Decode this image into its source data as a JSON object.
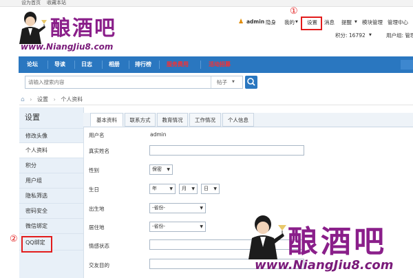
{
  "topbar": {
    "home_link": "设为首页",
    "fav_link": "收藏本站"
  },
  "logo": {
    "cn": "酿酒吧",
    "url": "www.NiangJiu8.com"
  },
  "userbar": {
    "username": "admin",
    "status": "隐身",
    "mine": "我的",
    "settings": "设置",
    "messages": "消息",
    "reminders": "提醒",
    "module_admin": "模块管理",
    "admin_center": "管理中心",
    "points": "积分: 16792",
    "user_group": "用户组: 管理"
  },
  "annotations": {
    "marker1": "①",
    "marker2": "②"
  },
  "nav": {
    "items": [
      "论坛",
      "导读",
      "日志",
      "相册",
      "排行榜",
      "服务费用",
      "活动招募"
    ]
  },
  "search": {
    "placeholder": "请输入搜索内容",
    "scope": "帖子"
  },
  "breadcrumb": {
    "home": "⌂",
    "sep": "›",
    "items": [
      "设置",
      "个人资料"
    ]
  },
  "sidebar": {
    "title": "设置",
    "items": [
      "修改头像",
      "个人资料",
      "积分",
      "用户组",
      "隐私筛选",
      "密码安全",
      "微信绑定",
      "QQ绑定"
    ]
  },
  "tabs": [
    "基本资料",
    "联系方式",
    "教育情况",
    "工作情况",
    "个人信息"
  ],
  "form": {
    "username_label": "用户名",
    "username_value": "admin",
    "realname_label": "真实姓名",
    "gender_label": "性别",
    "gender_value": "保密",
    "birthday_label": "生日",
    "year": "年",
    "month": "月",
    "day": "日",
    "birthplace_label": "出生地",
    "birthplace_value": "-省份-",
    "residence_label": "居住地",
    "residence_value": "-省份-",
    "marital_label": "情感状态",
    "purpose_label": "交友目的"
  },
  "watermark": {
    "cn": "酿酒吧",
    "url": "www.NiangJiu8.com"
  },
  "colors": {
    "nav_bg": "#2a77c0",
    "highlight": "#e21b1b",
    "nav_red": "#ff2d2d",
    "sidebar_bg": "#e8f0f8",
    "logo": "#8a1f8a"
  }
}
